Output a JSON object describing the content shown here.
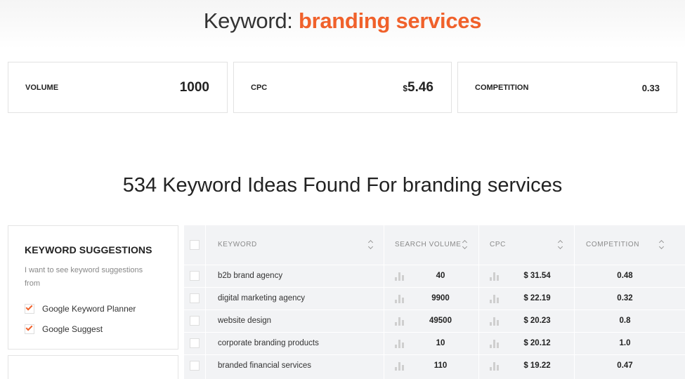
{
  "header": {
    "prefix": "Keyword:",
    "keyword": "branding services"
  },
  "metrics": [
    {
      "label": "VOLUME",
      "value": "1000"
    },
    {
      "label": "CPC",
      "currency": "$",
      "value": "5.46"
    },
    {
      "label": "COMPETITION",
      "value": "0.33"
    }
  ],
  "ideas_title": "534 Keyword Ideas Found For branding services",
  "suggestions": {
    "title": "KEYWORD SUGGESTIONS",
    "description": "I want to see keyword suggestions from",
    "options": [
      {
        "label": "Google Keyword Planner",
        "checked": true
      },
      {
        "label": "Google Suggest",
        "checked": true
      }
    ]
  },
  "table": {
    "columns": [
      "KEYWORD",
      "SEARCH VOLUME",
      "CPC",
      "COMPETITION"
    ],
    "rows": [
      {
        "keyword": "b2b brand agency",
        "volume": "40",
        "cpc": "$ 31.54",
        "competition": "0.48"
      },
      {
        "keyword": "digital marketing agency",
        "volume": "9900",
        "cpc": "$ 22.19",
        "competition": "0.32"
      },
      {
        "keyword": "website design",
        "volume": "49500",
        "cpc": "$ 20.23",
        "competition": "0.8"
      },
      {
        "keyword": "corporate branding products",
        "volume": "10",
        "cpc": "$ 20.12",
        "competition": "1.0"
      },
      {
        "keyword": "branded financial services",
        "volume": "110",
        "cpc": "$ 19.22",
        "competition": "0.47"
      }
    ]
  },
  "colors": {
    "accent": "#f0612b",
    "table_bg": "#f2f3f5"
  },
  "icons": {
    "sort": "sort-icon",
    "trend": "bar-chart-icon",
    "check": "checkmark-icon"
  }
}
